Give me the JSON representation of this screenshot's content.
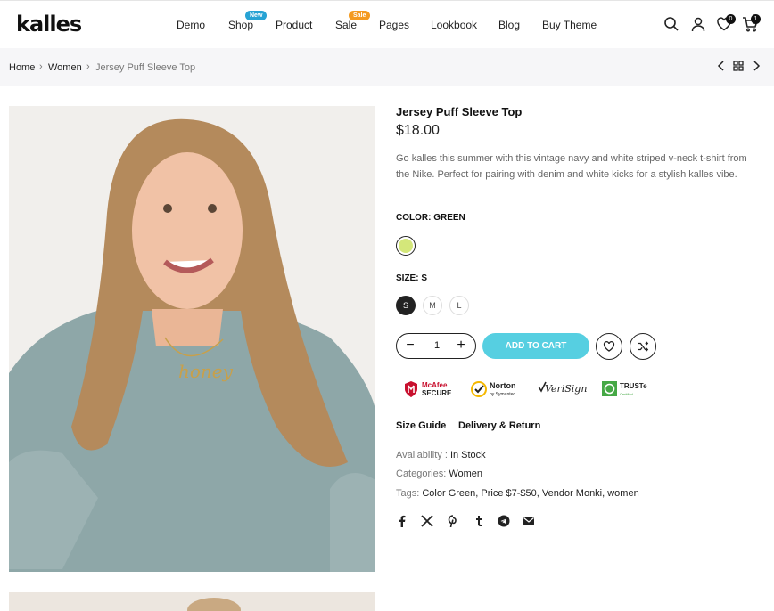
{
  "brand": {
    "logo": "kalles"
  },
  "nav": {
    "items": [
      {
        "label": "Demo"
      },
      {
        "label": "Shop",
        "badge": "New"
      },
      {
        "label": "Product"
      },
      {
        "label": "Sale",
        "badge": "Sale"
      },
      {
        "label": "Pages"
      },
      {
        "label": "Lookbook"
      },
      {
        "label": "Blog"
      },
      {
        "label": "Buy Theme"
      }
    ]
  },
  "header_icons": {
    "search": "search-icon",
    "account": "user-icon",
    "wishlist": "heart-icon",
    "wishlist_count": "0",
    "cart": "cart-icon",
    "cart_count": "1"
  },
  "breadcrumb": {
    "items": [
      "Home",
      "Women",
      "Jersey Puff Sleeve Top"
    ],
    "separator": "›"
  },
  "product": {
    "title": "Jersey Puff Sleeve Top",
    "price": "$18.00",
    "description": "Go kalles this summer with this vintage navy and white striped v-neck t-shirt from the Nike. Perfect for pairing with denim and white kicks for a stylish kalles vibe.",
    "color_label": "COLOR: ",
    "color_value": "GREEN",
    "color_swatch": "#d4e77a",
    "size_label": "SIZE: ",
    "size_value": "S",
    "sizes": [
      "S",
      "M",
      "L"
    ],
    "quantity": "1",
    "qty_minus": "−",
    "qty_plus": "+",
    "add_to_cart": "ADD TO CART",
    "accent_color": "#56cfe1",
    "trust_badges": [
      {
        "line1": "McAfee",
        "line2": "SECURE"
      },
      {
        "line1": "Norton",
        "line2": "by Symantec"
      },
      {
        "line1": "VeriSign",
        "line2": ""
      },
      {
        "line1": "TRUSTe",
        "line2": "Certified"
      }
    ],
    "size_guide": "Size Guide",
    "delivery_return": "Delivery & Return",
    "availability_label": "Availability : ",
    "availability_value": "In Stock",
    "categories_label": "Categories: ",
    "categories_value": "Women",
    "tags_label": "Tags: ",
    "tags_value": "Color Green, Price $7-$50, Vendor Monki, women"
  },
  "share_icons": [
    "facebook-icon",
    "x-icon",
    "pinterest-icon",
    "tumblr-icon",
    "telegram-icon",
    "email-icon"
  ]
}
